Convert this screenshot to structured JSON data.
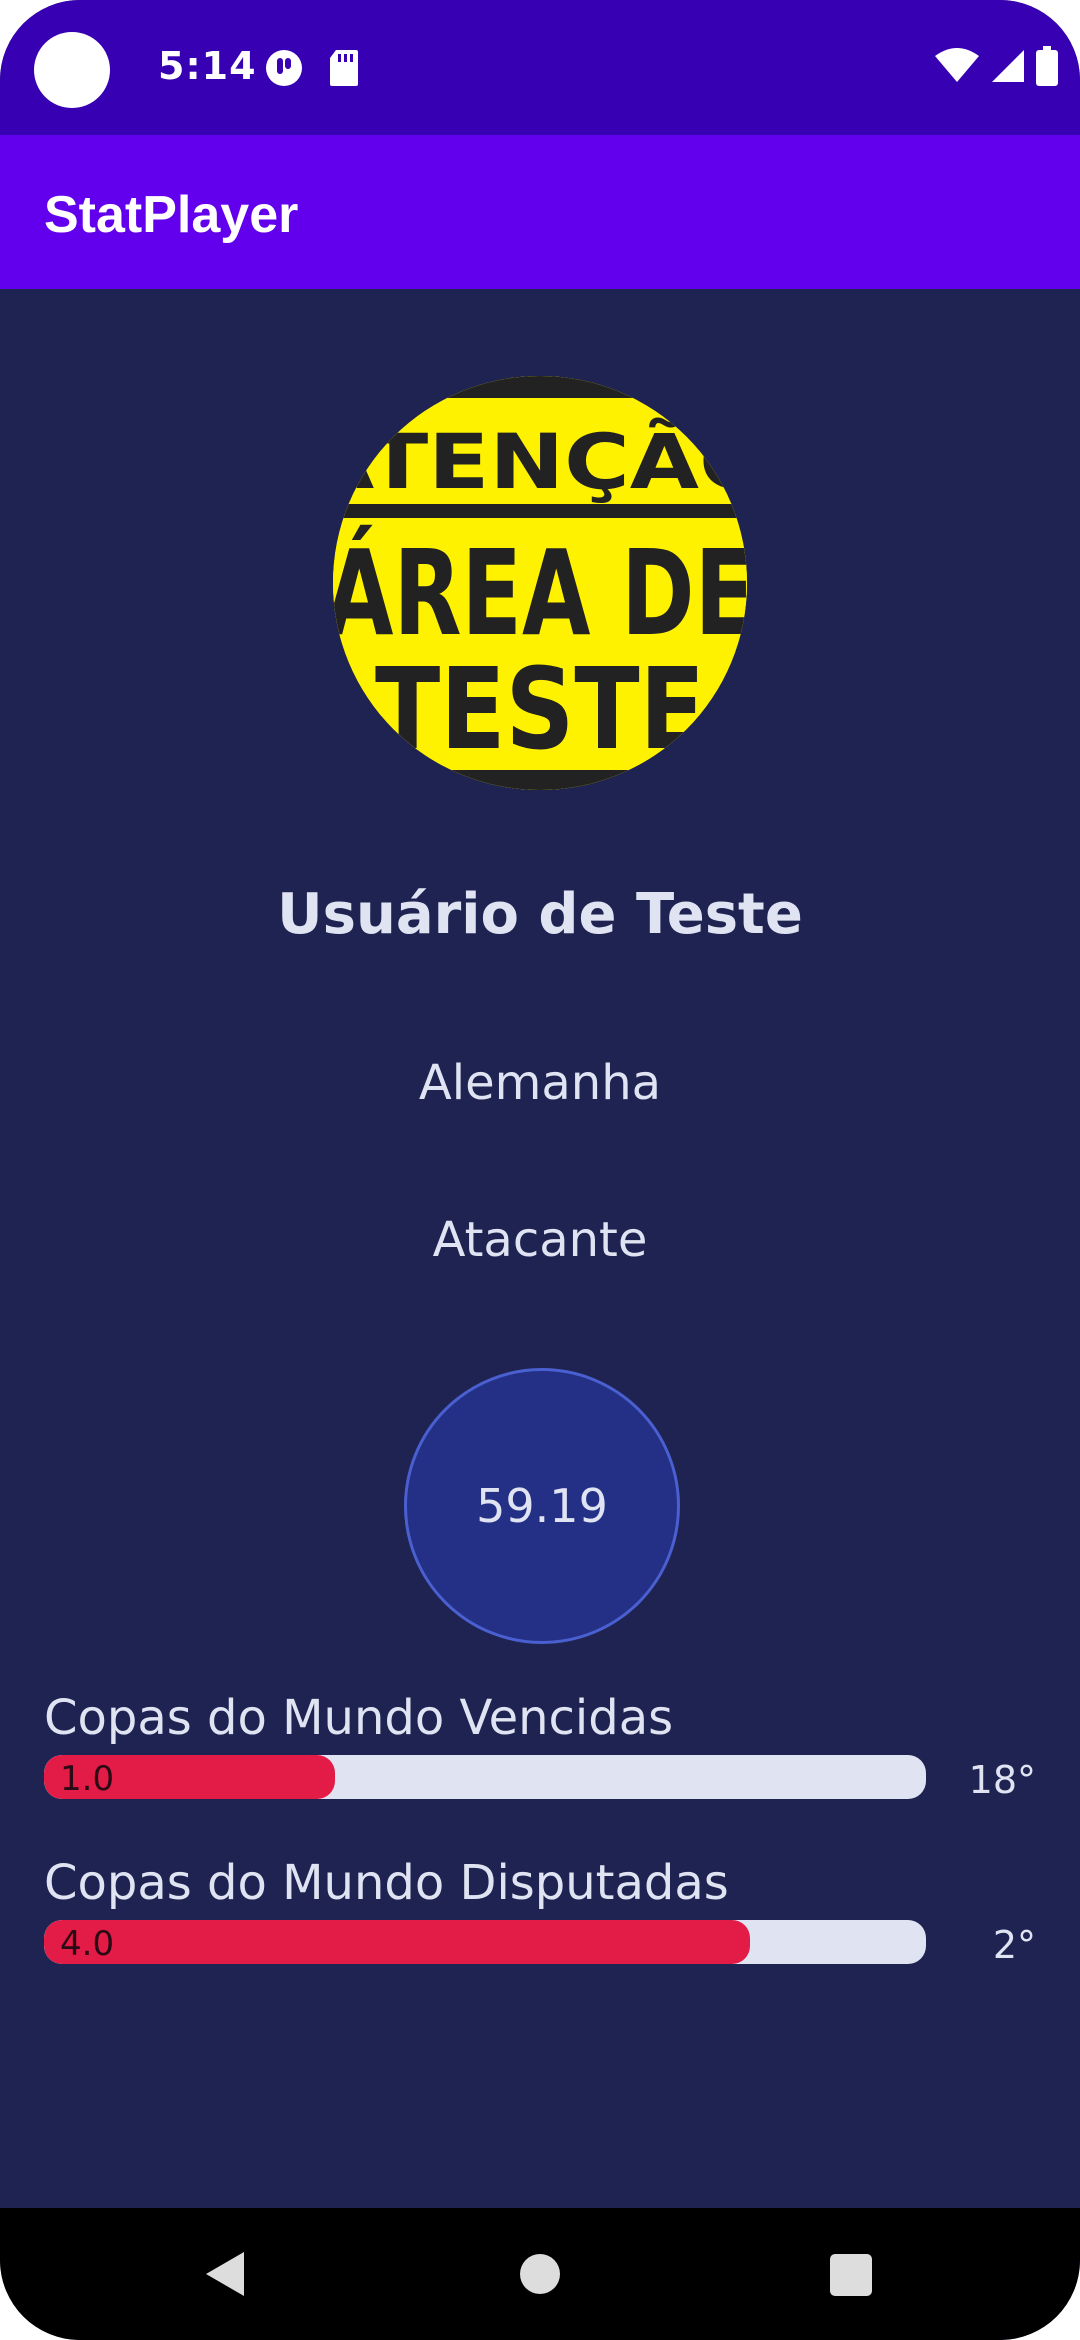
{
  "status_bar": {
    "time": "5:14",
    "icons": [
      "camera-cutout",
      "notification-icon",
      "sd-card-icon",
      "wifi-icon",
      "signal-icon",
      "battery-icon"
    ]
  },
  "app_bar": {
    "title": "StatPlayer"
  },
  "profile": {
    "avatar_text": [
      "ATENÇÃO",
      "ÁREA DE",
      "TESTE"
    ],
    "name": "Usuário de Teste",
    "country": "Alemanha",
    "position": "Atacante",
    "score": "59.19"
  },
  "stats": [
    {
      "label": "Copas do Mundo Vencidas",
      "value": "1.0",
      "fill": 0.33,
      "rank": "18°"
    },
    {
      "label": "Copas do Mundo Disputadas",
      "value": "4.0",
      "fill": 0.8,
      "rank": "2°"
    }
  ],
  "colors": {
    "status_bar": "#3700b3",
    "app_bar": "#6200ee",
    "background": "#1e2351",
    "score_circle": "#233086",
    "bar_fill": "#e21c46",
    "bar_track": "#dfe3f2",
    "avatar_yellow": "#fff200"
  },
  "nav_bar": {
    "icons": [
      "back-icon",
      "home-icon",
      "recents-icon"
    ]
  }
}
